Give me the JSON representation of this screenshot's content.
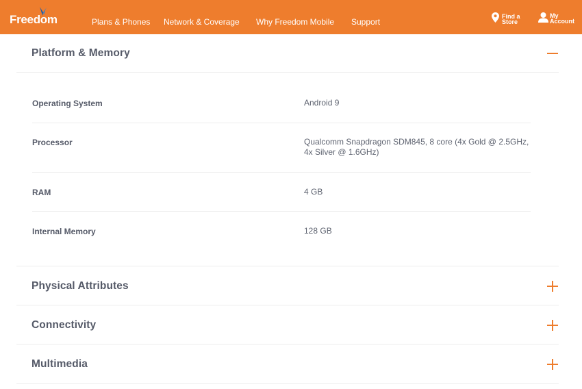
{
  "header": {
    "logo": "Freedom",
    "nav": [
      "Plans & Phones",
      "Network & Coverage",
      "Why Freedom Mobile",
      "Support"
    ],
    "find_store": [
      "Find a",
      "Store"
    ],
    "my_account": [
      "My",
      "Account"
    ]
  },
  "sections": [
    {
      "title": "Platform & Memory",
      "state": "expanded",
      "rows": [
        {
          "label": "Operating System",
          "value": "Android 9"
        },
        {
          "label": "Processor",
          "value": "Qualcomm Snapdragon SDM845, 8 core (4x Gold @ 2.5GHz, 4x Silver @ 1.6GHz)"
        },
        {
          "label": "RAM",
          "value": "4 GB"
        },
        {
          "label": "Internal Memory",
          "value": "128 GB"
        }
      ]
    },
    {
      "title": "Physical Attributes",
      "state": "collapsed"
    },
    {
      "title": "Connectivity",
      "state": "collapsed"
    },
    {
      "title": "Multimedia",
      "state": "collapsed"
    }
  ],
  "colors": {
    "brand": "#ee7d2d",
    "text": "#555a68",
    "divider": "#ececec"
  },
  "icons": {
    "expanded": "minus-icon",
    "collapsed": "plus-icon",
    "store": "location-pin-icon",
    "account": "person-icon"
  }
}
